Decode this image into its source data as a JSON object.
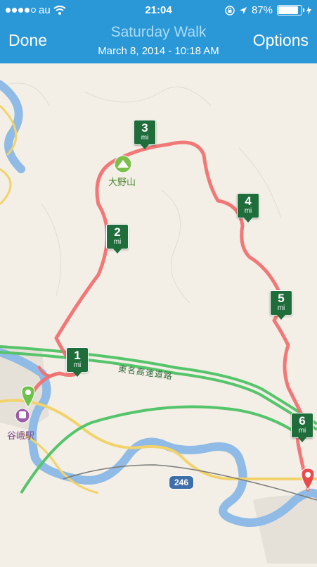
{
  "status_bar": {
    "carrier": "au",
    "time": "21:04",
    "battery": "87%",
    "battery_level": 0.87
  },
  "header": {
    "left_button": "Done",
    "title": "Saturday Walk",
    "subtitle": "March 8, 2014 - 10:18 AM",
    "right_button": "Options"
  },
  "map": {
    "mile_markers": [
      {
        "number": "1",
        "unit": "mi"
      },
      {
        "number": "2",
        "unit": "mi"
      },
      {
        "number": "3",
        "unit": "mi"
      },
      {
        "number": "4",
        "unit": "mi"
      },
      {
        "number": "5",
        "unit": "mi"
      },
      {
        "number": "6",
        "unit": "mi"
      }
    ],
    "mountain_label": "大野山",
    "station_label": "谷峨駅",
    "highway_label": "東名高速道路",
    "route_number": "246",
    "colors": {
      "route": "#f07171",
      "highway": "#55c46b",
      "river": "#8fbbe6",
      "road": "#f2d36b"
    }
  }
}
